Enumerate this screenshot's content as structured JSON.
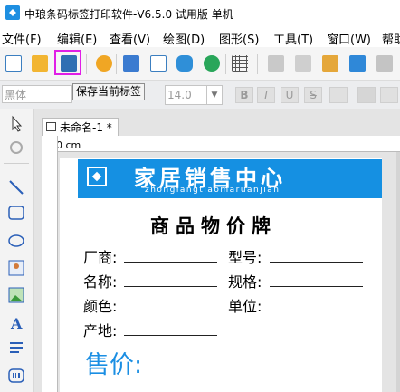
{
  "window": {
    "title": "中琅条码标签打印软件-V6.5.0 试用版 单机"
  },
  "menu": [
    "文件(F)",
    "编辑(E)",
    "查看(V)",
    "绘图(D)",
    "图形(S)",
    "工具(T)",
    "窗口(W)",
    "帮助"
  ],
  "toolbar": {
    "tooltip": "保存当前标签",
    "icons": [
      "new-icon",
      "open-folder-icon",
      "save-icon",
      "settings-icon",
      "print-icon",
      "print-preview-icon",
      "database-icon",
      "import-icon",
      "grid-icon",
      "cut-icon",
      "copy-icon",
      "paste-icon",
      "undo-icon",
      "redo-icon"
    ]
  },
  "format_bar": {
    "font": "黑体",
    "size": "14.0",
    "bold": "B",
    "italic": "I",
    "underline": "U",
    "strike": "S"
  },
  "document": {
    "tab_title": "未命名-1 *",
    "ruler_origin": "0 cm"
  },
  "label": {
    "banner_title": "家居销售中心",
    "banner_subtitle": "zhonglangtiaomaruanjian",
    "heading": "商品物价牌",
    "fields": {
      "maker": "厂商:",
      "model": "型号:",
      "name": "名称:",
      "spec": "规格:",
      "color": "颜色:",
      "unit": "单位:",
      "origin": "产地:"
    },
    "price": "售价:"
  },
  "colors": {
    "banner": "#1590e2",
    "price_text": "#1a8ee3",
    "highlight": "#e01ee6"
  }
}
